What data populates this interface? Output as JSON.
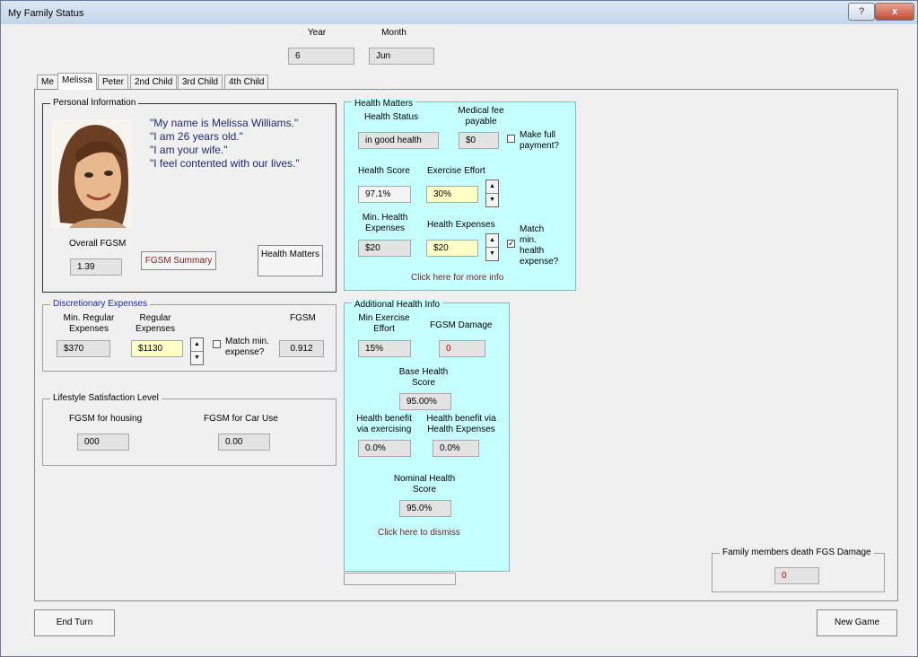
{
  "window": {
    "title": "My Family Status",
    "help": "?",
    "close": "x"
  },
  "date": {
    "year_label": "Year",
    "year_value": "6",
    "month_label": "Month",
    "month_value": "Jun"
  },
  "tabs": [
    "Me",
    "Melissa",
    "Peter",
    "2nd Child",
    "3rd Child",
    "4th Child"
  ],
  "active_tab": 1,
  "personal": {
    "title": "Personal Information",
    "quotes": [
      "\"My name is Melissa Williams.\"",
      "\"I am 26 years old.\"",
      "\"I am your wife.\"",
      "\"I feel contented with our lives.\""
    ],
    "overall_fgsm_label": "Overall FGSM",
    "overall_fgsm_value": "1.39",
    "fgsm_summary_btn": "FGSM Summary",
    "health_matters_btn": "Health Matters"
  },
  "discretionary": {
    "title": "Discretionary Expenses",
    "min_regular_label": "Min. Regular Expenses",
    "min_regular_value": "$370",
    "regular_label": "Regular Expenses",
    "regular_value": "$1130",
    "match_label": "Match min. expense?",
    "fgsm_label": "FGSM",
    "fgsm_value": "0.912"
  },
  "lifestyle": {
    "title": "Lifestyle Satisfaction Level",
    "housing_label": "FGSM for housing",
    "housing_value": "000",
    "car_label": "FGSM for Car Use",
    "car_value": "0.00"
  },
  "health": {
    "title": "Health Matters",
    "status_label": "Health Status",
    "status_value": "in good health",
    "medical_label": "Medical fee payable",
    "medical_value": "$0",
    "full_payment_label": "Make full payment?",
    "score_label": "Health Score",
    "score_value": "97.1%",
    "exercise_label": "Exercise Effort",
    "exercise_value": "30%",
    "min_exp_label": "Min. Health Expenses",
    "min_exp_value": "$20",
    "exp_label": "Health Expenses",
    "exp_value": "$20",
    "match_label": "Match min. health expense?",
    "more_info": "Click here for more info"
  },
  "additional": {
    "title": "Additional Health Info",
    "min_exercise_label": "Min Exercise Effort",
    "min_exercise_value": "15%",
    "damage_label": "FGSM Damage",
    "damage_value": "0",
    "base_label": "Base Health Score",
    "base_value": "95.00%",
    "benefit_ex_label": "Health benefit via exercising",
    "benefit_ex_value": "0.0%",
    "benefit_exp_label": "Health benefit via Health Expenses",
    "benefit_exp_value": "0.0%",
    "nominal_label": "Nominal Health Score",
    "nominal_value": "95.0%",
    "dismiss": "Click here to dismiss"
  },
  "death": {
    "title": "Family members death FGS Damage",
    "value": "0"
  },
  "footer": {
    "end_turn": "End Turn",
    "new_game": "New Game"
  }
}
